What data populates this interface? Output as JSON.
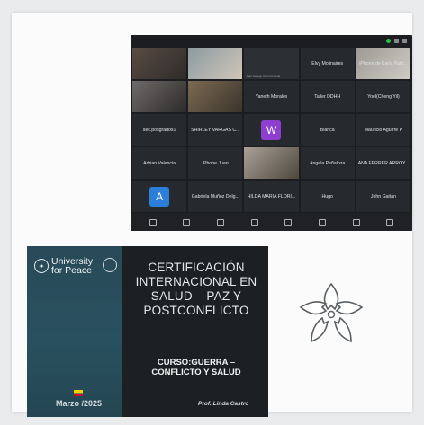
{
  "zoom": {
    "tiles": [
      {
        "label": "",
        "sub": "",
        "kind": "video"
      },
      {
        "label": "",
        "sub": "",
        "kind": "video2"
      },
      {
        "label": "",
        "sub": "Juan Gallego (tomó la toma)",
        "kind": "popup"
      },
      {
        "label": "Elvy Molinaires",
        "sub": "",
        "kind": "plain"
      },
      {
        "label": "iPhone de Karla Patri...",
        "sub": "",
        "kind": "video4"
      },
      {
        "label": "",
        "sub": "",
        "kind": "video3"
      },
      {
        "label": "",
        "sub": "",
        "kind": "video5"
      },
      {
        "label": "Yaneth Morales",
        "sub": "",
        "kind": "plain"
      },
      {
        "label": "Taller DDHH",
        "sub": "",
        "kind": "plain"
      },
      {
        "label": "Yoel(Cheng Yil)",
        "sub": "",
        "kind": "plain"
      },
      {
        "label": "sec.posgrados1",
        "sub": "",
        "kind": "plain"
      },
      {
        "label": "SHIRLEY VARGAS C...",
        "sub": "",
        "kind": "plain"
      },
      {
        "label": "",
        "sub": "",
        "kind": "avatar-w"
      },
      {
        "label": "Blanca",
        "sub": "",
        "kind": "plain"
      },
      {
        "label": "Mauricio Aguirre P",
        "sub": "",
        "kind": "plain"
      },
      {
        "label": "Adrian Valencia",
        "sub": "",
        "kind": "plain"
      },
      {
        "label": "iPhone Juan",
        "sub": "",
        "kind": "plain"
      },
      {
        "label": "",
        "sub": "",
        "kind": "video7"
      },
      {
        "label": "Ángela Peñaloza",
        "sub": "",
        "kind": "plain"
      },
      {
        "label": "ANA FERRER ARROY...",
        "sub": "",
        "kind": "plain"
      },
      {
        "label": "",
        "sub": "",
        "kind": "avatar-a"
      },
      {
        "label": "Gabriela Muñoz Delg...",
        "sub": "",
        "kind": "plain"
      },
      {
        "label": "HILDA MARIA FLORI...",
        "sub": "",
        "kind": "plain"
      },
      {
        "label": "Hugo",
        "sub": "",
        "kind": "plain"
      },
      {
        "label": "John Gaitán",
        "sub": "",
        "kind": "plain"
      }
    ],
    "avatar_w": {
      "letter": "W",
      "color": "#8e3fd0"
    },
    "avatar_a": {
      "letter": "A",
      "color": "#2c7fd9"
    },
    "toolbar": [
      {
        "icon": "mic-icon"
      },
      {
        "icon": "video-icon"
      },
      {
        "icon": "reactions-icon"
      },
      {
        "icon": "share-icon"
      },
      {
        "icon": "participants-icon"
      },
      {
        "icon": "ai-companion-icon"
      },
      {
        "icon": "apps-icon"
      },
      {
        "icon": "more-icon"
      }
    ]
  },
  "slide": {
    "org_line1": "University",
    "org_line2": "for Peace",
    "title_lines": [
      "CERTIFICACIÓN",
      "INTERNACIONAL EN",
      "SALUD – PAZ Y",
      "POSTCONFLICTO"
    ],
    "course_lines": [
      "CURSO:GUERRA –",
      "CONFLICTO Y SALUD"
    ],
    "date": "Marzo /2025",
    "professor": "Prof. Linda Castro",
    "colors": {
      "left_panel": "#294a58",
      "right_panel": "#1c2023"
    }
  }
}
